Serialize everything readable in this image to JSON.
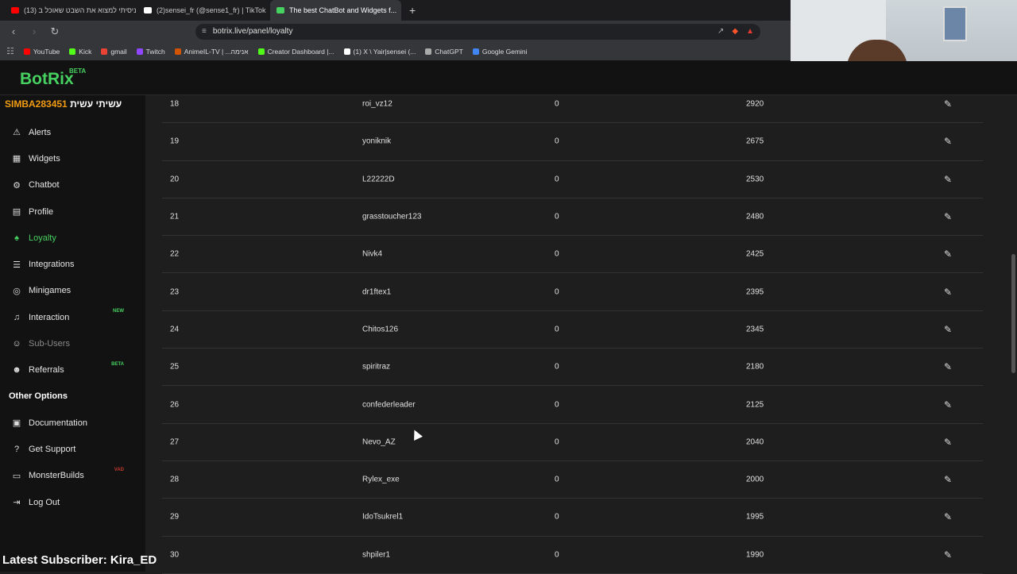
{
  "browser": {
    "tabs": [
      {
        "label": "(13) ניסיתי למצוא את השבט שאוכל ב...",
        "color": "#ff0000"
      },
      {
        "label": "(2)sensei_fr (@sense1_fr) | TikTok",
        "color": "#ffffff"
      },
      {
        "label": "The best ChatBot and Widgets f...",
        "color": "#46d160",
        "active": true
      }
    ],
    "url": "botrix.live/panel/loyalty",
    "bookmarks": [
      {
        "label": "YouTube",
        "color": "#ff0000"
      },
      {
        "label": "Kick",
        "color": "#53fc18"
      },
      {
        "label": "gmail",
        "color": "#ea4335"
      },
      {
        "label": "Twitch",
        "color": "#9146ff"
      },
      {
        "label": "AnimeIL-TV | ...אנימה",
        "color": "#d35400"
      },
      {
        "label": "Creator Dashboard |...",
        "color": "#53fc18"
      },
      {
        "label": "(1) X \\ Yair|sensei (...",
        "color": "#ffffff"
      },
      {
        "label": "ChatGPT",
        "color": "#aaaaaa"
      },
      {
        "label": "Google Gemini",
        "color": "#4285f4"
      }
    ]
  },
  "app": {
    "logo": "BotRix",
    "beta": "BETA",
    "username": "SIMBA283451",
    "username_overlay": "עשיתי עשית",
    "accent": "#46d160"
  },
  "sidebar": {
    "items": [
      {
        "label": "Alerts",
        "icon": "warning-icon"
      },
      {
        "label": "Widgets",
        "icon": "table-icon"
      },
      {
        "label": "Chatbot",
        "icon": "robot-icon"
      },
      {
        "label": "Profile",
        "icon": "id-card-icon"
      },
      {
        "label": "Loyalty",
        "icon": "trophy-icon",
        "active": true
      },
      {
        "label": "Integrations",
        "icon": "list-icon"
      },
      {
        "label": "Minigames",
        "icon": "gamepad-icon"
      },
      {
        "label": "Interaction",
        "icon": "music-icon",
        "tag": "NEW"
      },
      {
        "label": "Sub-Users",
        "icon": "user-icon",
        "disabled": true
      },
      {
        "label": "Referrals",
        "icon": "users-icon",
        "tag": "BETA"
      }
    ],
    "other_title": "Other Options",
    "other_items": [
      {
        "label": "Documentation",
        "icon": "book-icon"
      },
      {
        "label": "Get Support",
        "icon": "question-icon"
      },
      {
        "label": "MonsterBuilds",
        "icon": "monitor-icon",
        "tag": "VAD"
      },
      {
        "label": "Log Out",
        "icon": "logout-icon"
      }
    ]
  },
  "table": {
    "rows": [
      {
        "rank": "18",
        "name": "roi_vz12",
        "points": "0",
        "value": "2920"
      },
      {
        "rank": "19",
        "name": "yoniknik",
        "points": "0",
        "value": "2675"
      },
      {
        "rank": "20",
        "name": "L22222D",
        "points": "0",
        "value": "2530"
      },
      {
        "rank": "21",
        "name": "grasstoucher123",
        "points": "0",
        "value": "2480"
      },
      {
        "rank": "22",
        "name": "Nivk4",
        "points": "0",
        "value": "2425"
      },
      {
        "rank": "23",
        "name": "dr1ftex1",
        "points": "0",
        "value": "2395"
      },
      {
        "rank": "24",
        "name": "Chitos126",
        "points": "0",
        "value": "2345"
      },
      {
        "rank": "25",
        "name": "spiritraz",
        "points": "0",
        "value": "2180"
      },
      {
        "rank": "26",
        "name": "confederleader",
        "points": "0",
        "value": "2125"
      },
      {
        "rank": "27",
        "name": "Nevo_AZ",
        "points": "0",
        "value": "2040"
      },
      {
        "rank": "28",
        "name": "Rylex_exe",
        "points": "0",
        "value": "2000"
      },
      {
        "rank": "29",
        "name": "IdoTsukrel1",
        "points": "0",
        "value": "1995"
      },
      {
        "rank": "30",
        "name": "shpiler1",
        "points": "0",
        "value": "1990"
      }
    ]
  },
  "overlay": {
    "latest_subscriber": "Latest Subscriber: Kira_ED"
  }
}
